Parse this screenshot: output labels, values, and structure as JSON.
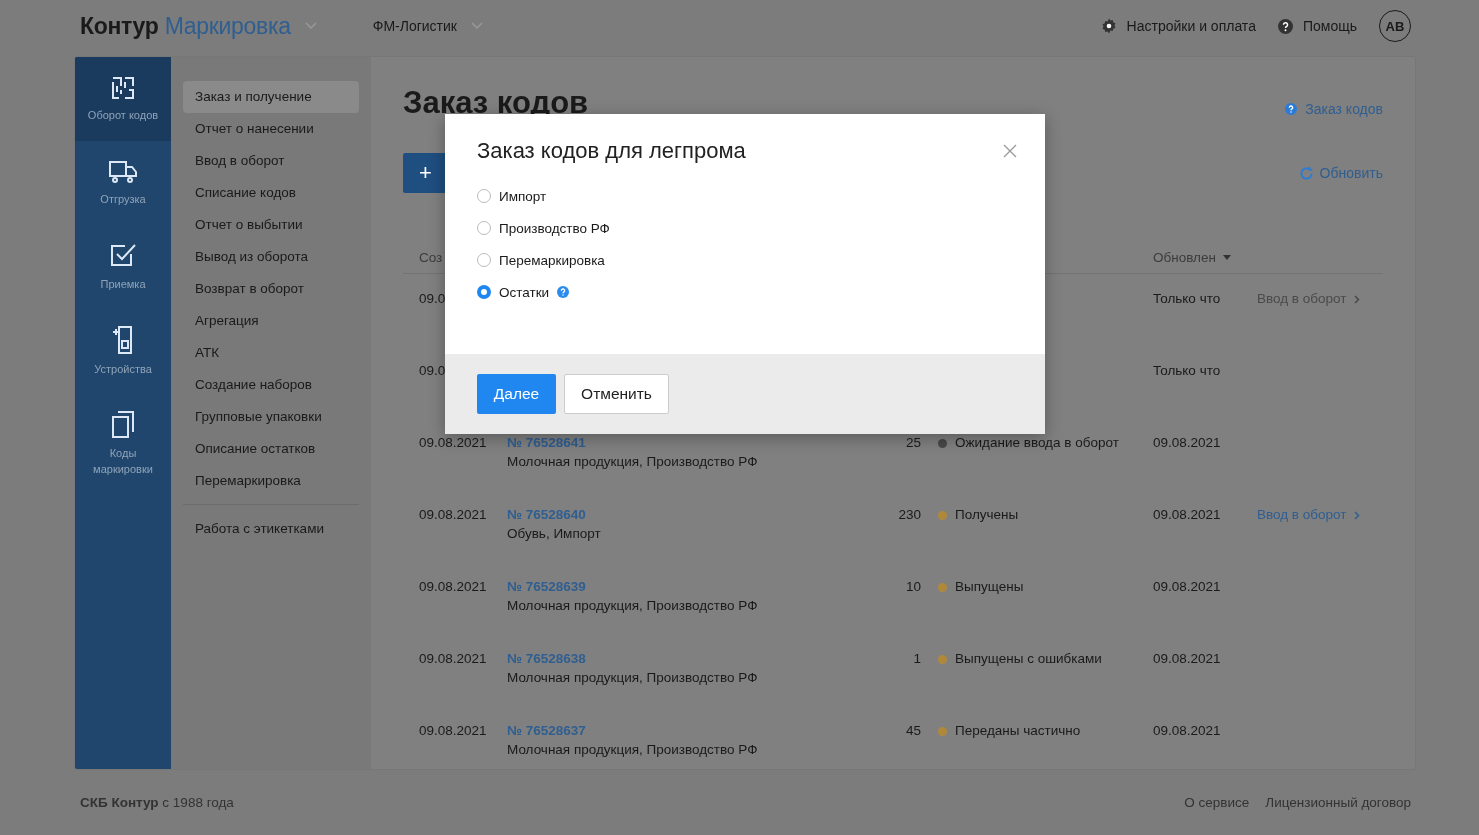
{
  "header": {
    "logo_brand": "Контур",
    "logo_product": "Маркировка",
    "organization": "ФМ-Логистик",
    "settings": "Настройки и оплата",
    "help": "Помощь",
    "avatar": "AB"
  },
  "nav": [
    {
      "kind": "codes",
      "label": "Оборот кодов",
      "selected": true
    },
    {
      "kind": "truck",
      "label": "Отгрузка",
      "selected": false
    },
    {
      "kind": "check",
      "label": "Приемка",
      "selected": false
    },
    {
      "kind": "device",
      "label": "Устройства",
      "selected": false
    },
    {
      "kind": "copies",
      "label": "Коды маркировки",
      "selected": false
    }
  ],
  "submenu": [
    {
      "items": [
        {
          "label": "Заказ и получение",
          "selected": true
        },
        {
          "label": "Отчет о нанесении",
          "selected": false
        },
        {
          "label": "Ввод в оборот",
          "selected": false
        },
        {
          "label": "Списание кодов",
          "selected": false
        },
        {
          "label": "Отчет о выбытии",
          "selected": false
        },
        {
          "label": "Вывод из оборота",
          "selected": false
        },
        {
          "label": "Возврат в оборот",
          "selected": false
        },
        {
          "label": "Агрегация",
          "selected": false
        },
        {
          "label": "АТК",
          "selected": false
        },
        {
          "label": "Создание наборов",
          "selected": false
        },
        {
          "label": "Групповые упаковки",
          "selected": false
        },
        {
          "label": "Описание остатков",
          "selected": false
        },
        {
          "label": "Перемаркировка",
          "selected": false
        }
      ]
    },
    {
      "items": [
        {
          "label": "Работа с этикетками",
          "selected": false
        }
      ]
    }
  ],
  "page": {
    "title": "Заказ кодов",
    "help_link": "Заказ кодов",
    "create_button": "+",
    "refresh": "Обновить"
  },
  "table": {
    "columns": {
      "created": "Соз",
      "updated": "Обновлен"
    },
    "rows": [
      {
        "date": "09.0",
        "updated": "Только что",
        "action": {
          "label": "Ввод в оборот",
          "disabled": true
        }
      },
      {
        "date": "09.0",
        "updated": "Только что"
      },
      {
        "date": "09.08.2021",
        "number": "№ 76528641",
        "name": "Молочная продукция, Производство РФ",
        "count": "25",
        "status": "Ожидание ввода в оборот",
        "color": "#484848",
        "updated": "09.08.2021"
      },
      {
        "date": "09.08.2021",
        "number": "№ 76528640",
        "name": "Обувь, Импорт",
        "count": "230",
        "status": "Получены",
        "color": "#b0883c",
        "updated": "09.08.2021",
        "action": {
          "label": "Ввод в оборот",
          "disabled": false
        }
      },
      {
        "date": "09.08.2021",
        "number": "№ 76528639",
        "name": "Молочная продукция, Производство РФ",
        "count": "10",
        "status": "Выпущены",
        "color": "#b0883c",
        "updated": "09.08.2021"
      },
      {
        "date": "09.08.2021",
        "number": "№ 76528638",
        "name": "Молочная продукция, Производство РФ",
        "count": "1",
        "status": "Выпущены с ошибками",
        "color": "#b0883c",
        "updated": "09.08.2021"
      },
      {
        "date": "09.08.2021",
        "number": "№ 76528637",
        "name": "Молочная продукция, Производство РФ",
        "count": "45",
        "status": "Переданы частично",
        "color": "#b0883c",
        "updated": "09.08.2021"
      }
    ]
  },
  "footer": {
    "copyright": "**СКБ Контур** с 1988 года",
    "links": [
      "О сервисе",
      "Лицензионный договор"
    ]
  },
  "modal": {
    "title": "Заказ кодов для легпрома",
    "options": [
      {
        "label": "Импорт",
        "selected": false
      },
      {
        "label": "Производство РФ",
        "selected": false
      },
      {
        "label": "Перемаркировка",
        "selected": false
      },
      {
        "label": "Остатки",
        "selected": true,
        "help": true
      }
    ],
    "primary": "Далее",
    "secondary": "Отменить"
  }
}
